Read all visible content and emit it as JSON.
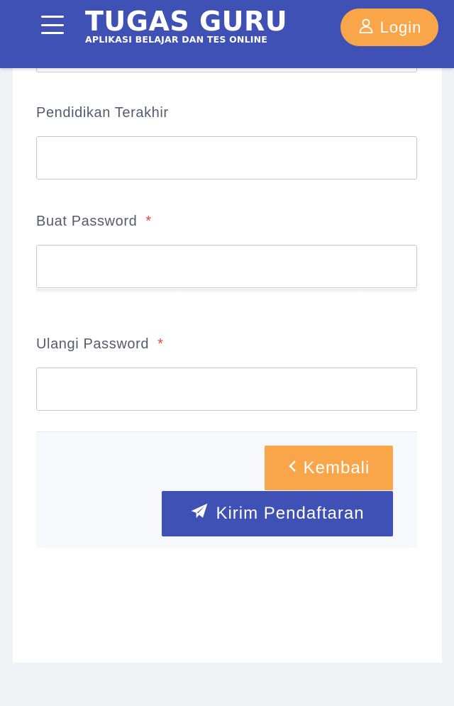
{
  "header": {
    "brand_title": "TUGAS GURU",
    "brand_subtitle": "APLIKASI BELAJAR DAN TES ONLINE",
    "login_label": "Login",
    "menu_icon": "hamburger-menu-icon",
    "login_icon": "user-icon"
  },
  "form": {
    "fields": [
      {
        "label": "Pendidikan Terakhir",
        "required": false,
        "value": ""
      },
      {
        "label": "Buat Password",
        "required": true,
        "required_mark": "*",
        "value": ""
      },
      {
        "label": "Ulangi Password",
        "required": true,
        "required_mark": "*",
        "value": ""
      }
    ],
    "back_label": "Kembali",
    "back_icon": "chevron-left-icon",
    "submit_label": "Kirim Pendaftaran",
    "submit_icon": "paper-plane-icon"
  },
  "colors": {
    "primary": "#3f51b5",
    "accent": "#f9a54a",
    "required": "#e0483c",
    "background": "#f1f2f6"
  }
}
